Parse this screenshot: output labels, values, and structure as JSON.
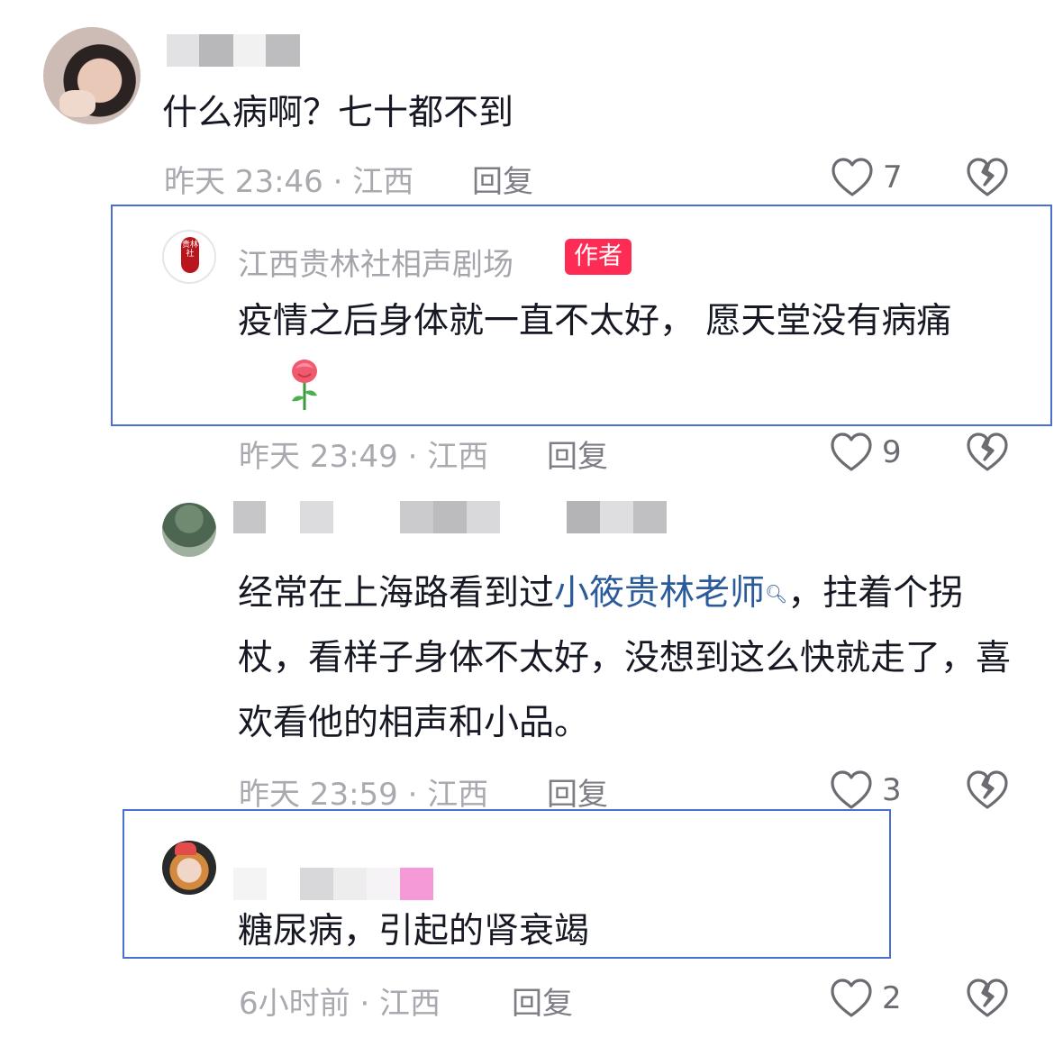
{
  "comments": [
    {
      "text": "什么病啊？七十都不到",
      "meta": "昨天 23:46 · 江西",
      "reply": "回复",
      "likes": "7"
    },
    {
      "username": "江西贵林社相声剧场",
      "badge": "作者",
      "avatar_text": "贵林社",
      "text": "疫情之后身体就一直不太好，  愿天堂没有病痛",
      "meta": "昨天 23:49 · 江西",
      "reply": "回复",
      "likes": "9"
    },
    {
      "text_prefix": "经常在上海路看到过",
      "mention": "小筱贵林老师",
      "text_suffix": "，拄着个拐杖，看样子身体不太好，没想到这么快就走了，喜欢看他的相声和小品。",
      "meta": "昨天 23:59 · 江西",
      "reply": "回复",
      "likes": "3"
    },
    {
      "text": "糖尿病，引起的肾衰竭",
      "meta": "6小时前 · 江西",
      "reply": "回复",
      "likes": "2"
    }
  ],
  "icons": {
    "like": "heart-outline-icon",
    "dislike": "broken-heart-icon",
    "search": "search-icon",
    "rose": "rose-emoji-icon"
  },
  "colors": {
    "author_badge": "#fe2c55",
    "mention_link": "#2c5b9c",
    "highlight_border": "#4a6fd0",
    "meta_text": "#a9aab0"
  }
}
